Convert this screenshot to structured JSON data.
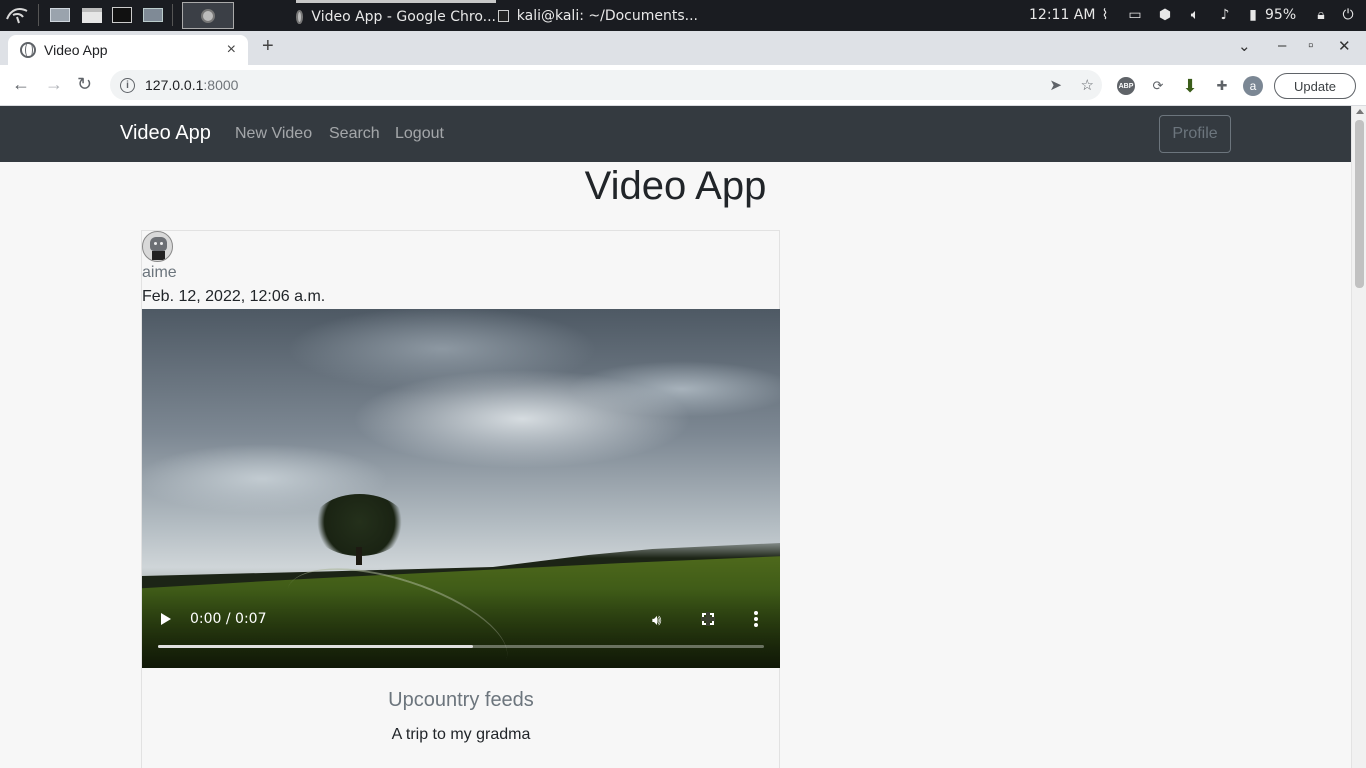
{
  "os_taskbar": {
    "tasks": [
      {
        "label": "Video App - Google Chro..."
      },
      {
        "label": "kali@kali: ~/Documents..."
      }
    ],
    "clock": "12:11 AM",
    "battery": "95%"
  },
  "browser": {
    "tab_title": "Video App",
    "tab_close": "×",
    "new_tab": "+",
    "url_host": "127.0.0.1",
    "url_port": ":8000",
    "update_label": "Update",
    "profile_initial": "a",
    "abp_label": "ABP"
  },
  "navbar": {
    "brand": "Video App",
    "links": [
      "New Video",
      "Search",
      "Logout"
    ],
    "profile_button": "Profile"
  },
  "page": {
    "heading": "Video App"
  },
  "post": {
    "username": "aime",
    "date": "Feb. 12, 2022, 12:06 a.m.",
    "video": {
      "time": "0:00 / 0:07",
      "buffered_fraction": 0.52
    },
    "title": "Upcountry feeds",
    "description": "A trip to my gradma"
  },
  "colors": {
    "navbar_bg": "#343a40",
    "page_bg": "#f7f7f7",
    "muted_text": "#6c757d"
  }
}
